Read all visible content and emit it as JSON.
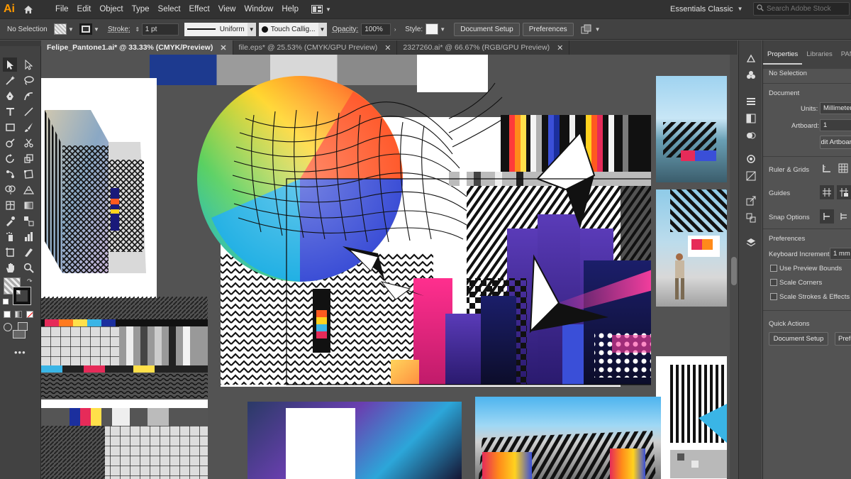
{
  "app": {
    "logo": "Ai"
  },
  "menu": [
    "File",
    "Edit",
    "Object",
    "Type",
    "Select",
    "Effect",
    "View",
    "Window",
    "Help"
  ],
  "workspace": "Essentials Classic",
  "search": {
    "placeholder": "Search Adobe Stock"
  },
  "control_bar": {
    "selection": "No Selection",
    "stroke_label": "Stroke:",
    "stroke_value": "1 pt",
    "profile": "Uniform",
    "brush": "Touch Callig...",
    "opacity_label": "Opacity:",
    "opacity_value": "100%",
    "style_label": "Style:",
    "doc_setup": "Document Setup",
    "preferences": "Preferences"
  },
  "tabs": [
    {
      "label": "Felipe_Pantone1.ai* @ 33.33% (CMYK/Preview)",
      "active": true
    },
    {
      "label": "file.eps* @ 25.53% (CMYK/GPU Preview)",
      "active": false
    },
    {
      "label": "2327260.ai* @ 66.67% (RGB/GPU Preview)",
      "active": false
    }
  ],
  "panel": {
    "tabs": [
      "Properties",
      "Libraries",
      "PANT"
    ],
    "selection": "No Selection",
    "document_heading": "Document",
    "units_label": "Units:",
    "units_value": "Millimeters",
    "artboard_label": "Artboard:",
    "artboard_value": "1",
    "edit_artboards": "Edit Artboards",
    "ruler_grids": "Ruler & Grids",
    "guides": "Guides",
    "snap_options": "Snap Options",
    "preferences_heading": "Preferences",
    "keyboard_increment_label": "Keyboard Increment:",
    "keyboard_increment_value": "1 mm",
    "use_preview_bounds": "Use Preview Bounds",
    "scale_corners": "Scale Corners",
    "scale_strokes": "Scale Strokes & Effects",
    "quick_actions": "Quick Actions",
    "document_setup": "Document Setup",
    "preferences_btn": "Preferences"
  },
  "colors": {
    "app_accent": "#ff9a00",
    "ui_dark": "#323232",
    "ui_mid": "#424242",
    "canvas_bg": "#535353"
  }
}
